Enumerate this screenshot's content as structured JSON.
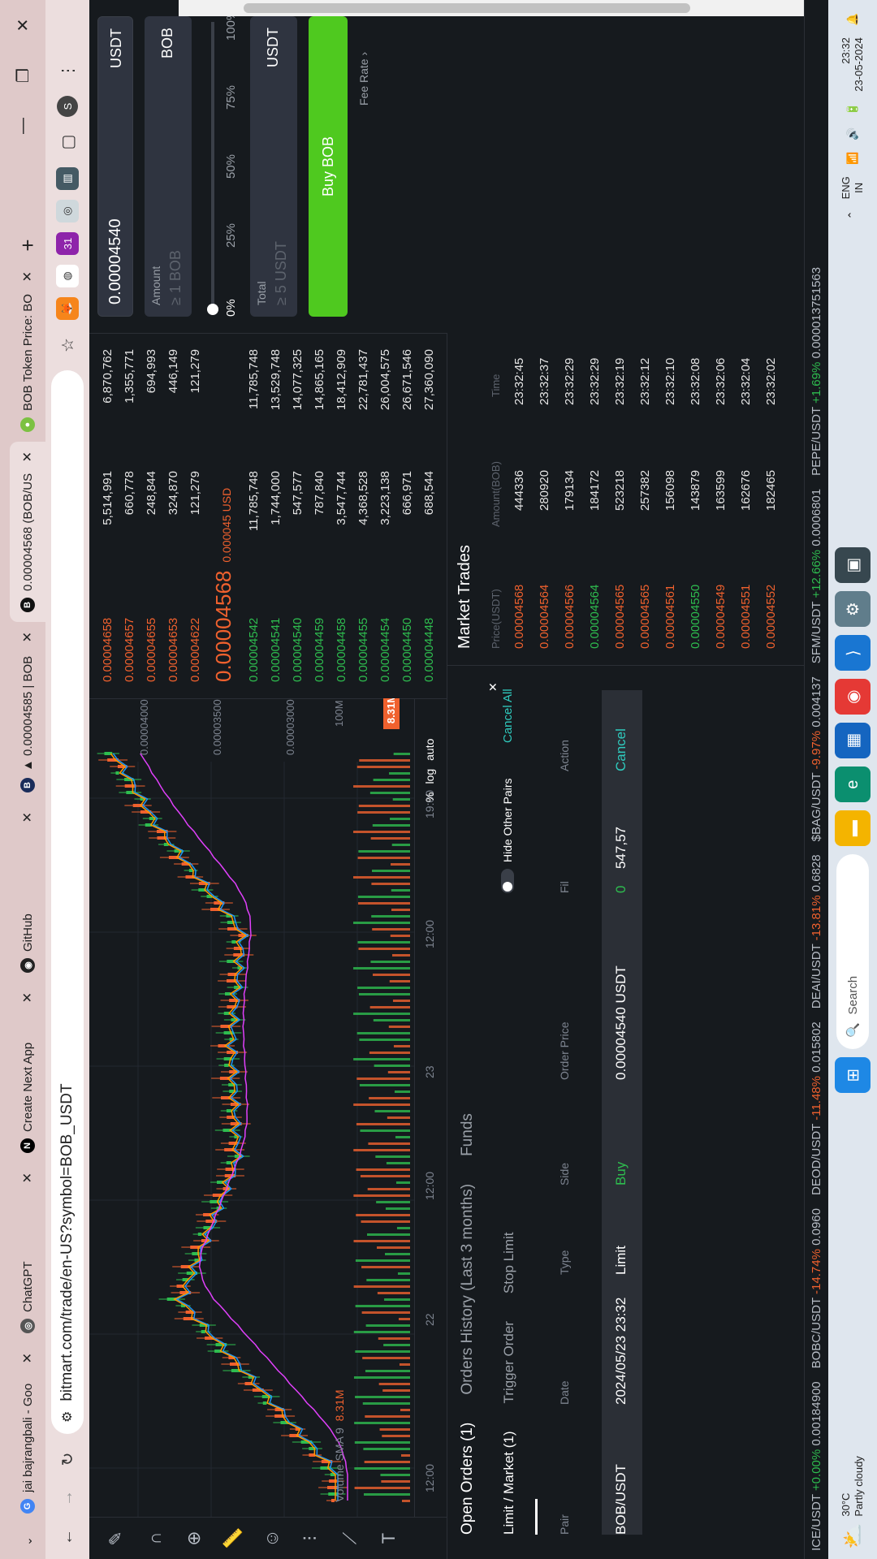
{
  "tabs": [
    {
      "title": "jai bajrangbali - Goo",
      "favicon": "G",
      "color": "#4285f4"
    },
    {
      "title": "ChatGPT",
      "favicon": "◎",
      "color": "#555"
    },
    {
      "title": "Create Next App",
      "favicon": "N",
      "color": "#000"
    },
    {
      "title": "GitHub",
      "favicon": "◉",
      "color": "#222"
    },
    {
      "title": "▲ 0.00004585 | BOB",
      "favicon": "B",
      "color": "#1a2c5a"
    },
    {
      "title": "0.00004568 (BOB/US",
      "favicon": "B",
      "color": "#111"
    },
    {
      "title": "BOB Token Price: BO",
      "favicon": "●",
      "color": "#7cc142"
    }
  ],
  "address": {
    "url": "bitmart.com/trade/en-US?symbol=BOB_USDT"
  },
  "extensions": [
    {
      "name": "metamask-icon",
      "label": "🦊"
    },
    {
      "name": "colorwheel-icon",
      "label": "◍"
    },
    {
      "name": "calendar-icon",
      "label": "31"
    },
    {
      "name": "screenshot-icon",
      "label": "◎"
    },
    {
      "name": "book-icon",
      "label": "▥"
    }
  ],
  "profile": "S",
  "chart": {
    "time_labels": [
      "12:00",
      "22",
      "12:00",
      "23",
      "12:00",
      "19:00"
    ],
    "price_labels": [
      "0.00004000",
      "0.00003500",
      "0.00003000"
    ],
    "volume_label": "Volume SMA 9",
    "volume_value": "8.31M",
    "volume_axis": "100M",
    "volume_badge": "8.31M",
    "clock": "18:02 (UTC)",
    "pct": "%",
    "log": "log",
    "auto": "auto"
  },
  "orderbook": {
    "asks": [
      {
        "price": "0.00004658",
        "amount": "5,514,991",
        "total": "6,870,762"
      },
      {
        "price": "0.00004657",
        "amount": "660,778",
        "total": "1,355,771"
      },
      {
        "price": "0.00004655",
        "amount": "248,844",
        "total": "694,993"
      },
      {
        "price": "0.00004653",
        "amount": "324,870",
        "total": "446,149"
      },
      {
        "price": "0.00004622",
        "amount": "121,279",
        "total": "121,279"
      }
    ],
    "last_price": "0.00004568",
    "last_usd": "0.000045 USD",
    "bids": [
      {
        "price": "0.00004542",
        "amount": "11,785,748",
        "total": "11,785,748"
      },
      {
        "price": "0.00004541",
        "amount": "1,744,000",
        "total": "13,529,748"
      },
      {
        "price": "0.00004540",
        "amount": "547,577",
        "total": "14,077,325"
      },
      {
        "price": "0.00004459",
        "amount": "787,840",
        "total": "14,865,165"
      },
      {
        "price": "0.00004458",
        "amount": "3,547,744",
        "total": "18,412,909"
      },
      {
        "price": "0.00004455",
        "amount": "4,368,528",
        "total": "22,781,437"
      },
      {
        "price": "0.00004454",
        "amount": "3,223,138",
        "total": "26,004,575"
      },
      {
        "price": "0.00004450",
        "amount": "666,971",
        "total": "26,671,546"
      },
      {
        "price": "0.00004448",
        "amount": "688,544",
        "total": "27,360,090"
      }
    ]
  },
  "tradeform": {
    "price_value": "0.00004540",
    "price_unit": "USDT",
    "amount_label": "Amount",
    "amount_placeholder": "≥ 1 BOB",
    "amount_unit": "BOB",
    "slider_marks": [
      "0%",
      "25%",
      "50%",
      "75%",
      "100%"
    ],
    "total_label": "Total",
    "total_placeholder": "≥ 5 USDT",
    "total_unit": "USDT",
    "buy_label": "Buy BOB",
    "fee_rate": "Fee Rate"
  },
  "orders": {
    "tabs": [
      "Open Orders (1)",
      "Orders History (Last 3 months)",
      "Funds"
    ],
    "subtabs": [
      "Limit / Market (1)",
      "Trigger Order",
      "Stop Limit"
    ],
    "hide_pairs": "Hide Other Pairs",
    "cancel_all": "Cancel All",
    "headers": [
      "Pair",
      "Date",
      "Type",
      "Side",
      "Order Price",
      "Fil",
      "Action"
    ],
    "row": {
      "pair": "BOB/USDT",
      "date": "2024/05/23 23:32",
      "type": "Limit",
      "side": "Buy",
      "price": "0.00004540 USDT",
      "filled": "0",
      "total": "547,57",
      "action": "Cancel"
    }
  },
  "trades": {
    "title": "Market Trades",
    "headers": [
      "Price(USDT)",
      "Amount(BOB)",
      "Time"
    ],
    "rows": [
      {
        "price": "0.00004568",
        "amount": "444336",
        "time": "23:32:45",
        "side": "red"
      },
      {
        "price": "0.00004564",
        "amount": "280920",
        "time": "23:32:37",
        "side": "red"
      },
      {
        "price": "0.00004566",
        "amount": "179134",
        "time": "23:32:29",
        "side": "red"
      },
      {
        "price": "0.00004564",
        "amount": "184172",
        "time": "23:32:29",
        "side": "green"
      },
      {
        "price": "0.00004565",
        "amount": "523218",
        "time": "23:32:19",
        "side": "red"
      },
      {
        "price": "0.00004565",
        "amount": "257382",
        "time": "23:32:12",
        "side": "red"
      },
      {
        "price": "0.00004561",
        "amount": "156098",
        "time": "23:32:10",
        "side": "red"
      },
      {
        "price": "0.00004550",
        "amount": "143879",
        "time": "23:32:08",
        "side": "green"
      },
      {
        "price": "0.00004549",
        "amount": "163599",
        "time": "23:32:06",
        "side": "red"
      },
      {
        "price": "0.00004551",
        "amount": "162676",
        "time": "23:32:04",
        "side": "red"
      },
      {
        "price": "0.00004552",
        "amount": "182465",
        "time": "23:32:02",
        "side": "red"
      }
    ]
  },
  "ticker": [
    {
      "pair": "ICE/USDT",
      "chg": "+0.00%",
      "price": "0.00184900",
      "dir": "green"
    },
    {
      "pair": "BOBC/USDT",
      "chg": "-14.74%",
      "price": "0.0960",
      "dir": "red"
    },
    {
      "pair": "DEOD/USDT",
      "chg": "-11.48%",
      "price": "0.015802",
      "dir": "red"
    },
    {
      "pair": "DEAI/USDT",
      "chg": "-13.81%",
      "price": "0.6828",
      "dir": "red"
    },
    {
      "pair": "$BAG/USDT",
      "chg": "-9.97%",
      "price": "0.004137",
      "dir": "red"
    },
    {
      "pair": "SFM/USDT",
      "chg": "+12.66%",
      "price": "0.0006801",
      "dir": "green"
    },
    {
      "pair": "PEPE/USDT",
      "chg": "+1.69%",
      "price": "0.000013751563",
      "dir": "green"
    }
  ],
  "taskbar": {
    "weather_temp": "30°C",
    "weather_desc": "Partly cloudy",
    "search": "Search",
    "lang": "ENG",
    "region": "IN",
    "time": "23:32",
    "date": "23-05-2024"
  }
}
